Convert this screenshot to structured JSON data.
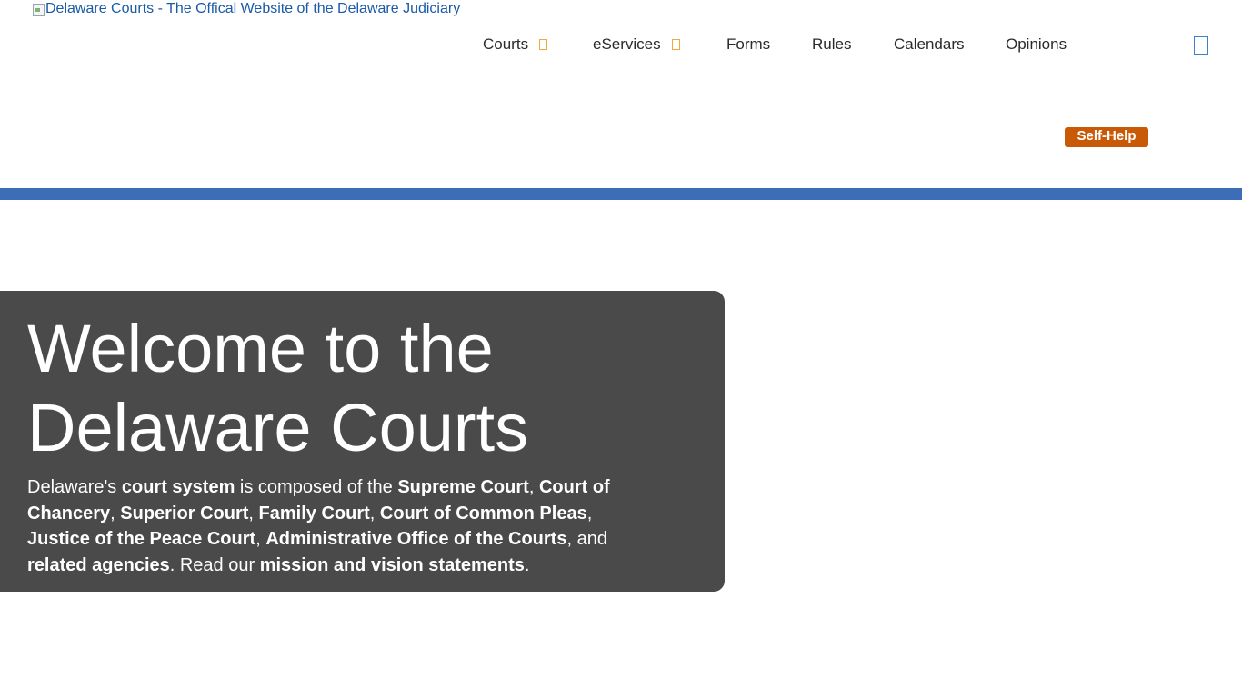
{
  "header": {
    "logo_alt": "Delaware Courts - The Offical Website of the Delaware Judiciary"
  },
  "nav": {
    "items": [
      {
        "label": "Courts",
        "dropdown": true
      },
      {
        "label": "eServices",
        "dropdown": true
      },
      {
        "label": "Forms",
        "dropdown": false
      },
      {
        "label": "Rules",
        "dropdown": false
      },
      {
        "label": "Calendars",
        "dropdown": false
      },
      {
        "label": "Opinions",
        "dropdown": false
      }
    ],
    "search_icon": "search-icon",
    "dropdown_icon": "chevron-down-icon"
  },
  "self_help": {
    "label": "Self-Help"
  },
  "hero": {
    "title_line1": "Welcome to the",
    "title_line2": "Delaware Courts",
    "t1": "Delaware's ",
    "l_court_system": "court system",
    "t2": " is composed of the ",
    "l_supreme": "Supreme Court",
    "t3": ", ",
    "l_chancery": "Court of Chancery",
    "t4": ", ",
    "l_superior": "Superior Court",
    "t5": ", ",
    "l_family": "Family Court",
    "t6": ", ",
    "l_common_pleas": "Court of Common Pleas",
    "t7": ", ",
    "l_jp": "Justice of the Peace Court",
    "t8": ", ",
    "l_aoc": "Administrative Office of the Courts",
    "t9": ", and ",
    "l_related": "related agencies",
    "t10": ". Read our ",
    "l_mission": "mission and vision statements",
    "t11": "."
  },
  "colors": {
    "accent_blue": "#3d6db6",
    "self_help_orange": "#c85a07",
    "hero_background": "#4a4a4a",
    "dropdown_caret": "#f0a93a",
    "logo_link": "#1a5aa6"
  }
}
